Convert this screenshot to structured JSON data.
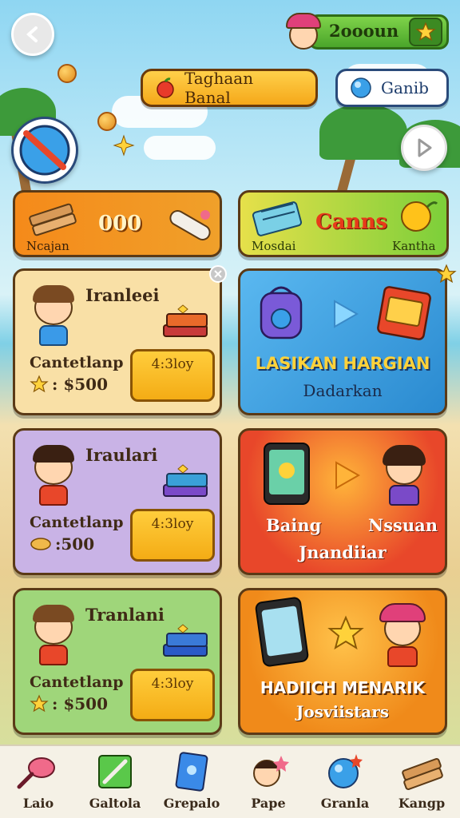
{
  "header": {
    "coin_amount": "2oooun",
    "event_label": "Taghaan Banal",
    "gem_label": "Ganib"
  },
  "banners": {
    "left": {
      "caption": "Ncajan",
      "value": "000"
    },
    "right": {
      "title": "Canns",
      "caption_left": "Mosdai",
      "caption_right": "Kantha"
    }
  },
  "offers": [
    {
      "name": "Iranleei",
      "subtitle": "Cantetlanp",
      "price": ": $500",
      "buy_label": "4:3loy",
      "bg": "#f9e0a6"
    },
    {
      "name": "Iraulari",
      "subtitle": "Cantetlanp",
      "price": ":500",
      "buy_label": "4:3loy",
      "bg": "#c9b3e6"
    },
    {
      "name": "Tranlani",
      "subtitle": "Cantetlanp",
      "price": ": $500",
      "buy_label": "4:3loy",
      "bg": "#9fd67a"
    }
  ],
  "promos": [
    {
      "title": "LASIKAN HARGIAN",
      "subtitle": "Dadarkan",
      "bg": "#45a8e6"
    },
    {
      "title_left": "Baing",
      "title_right": "Nssuan",
      "subtitle": "Jnandiiar",
      "bg": "#e8472a"
    },
    {
      "title": "HADIICH MENARIK",
      "subtitle": "Josviistars",
      "bg": "#f0a020"
    }
  ],
  "nav": [
    {
      "label": "Laio",
      "icon": "wand-icon"
    },
    {
      "label": "Galtola",
      "icon": "sword-icon"
    },
    {
      "label": "Grepalo",
      "icon": "card-icon"
    },
    {
      "label": "Pape",
      "icon": "avatar-icon"
    },
    {
      "label": "Granla",
      "icon": "globe-icon"
    },
    {
      "label": "Kangp",
      "icon": "wood-icon"
    }
  ]
}
